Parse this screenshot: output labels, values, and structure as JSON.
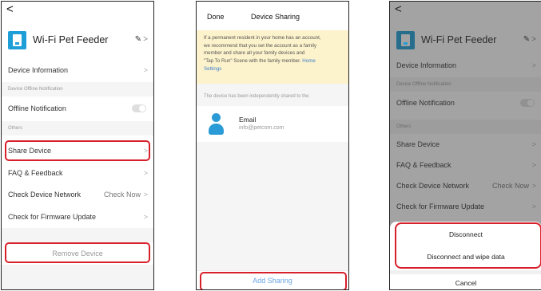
{
  "screen1": {
    "back": "<",
    "device_name": "Wi-Fi Pet Feeder",
    "edit_glyph": "✎",
    "chevron": ">",
    "items": {
      "device_information": "Device Information",
      "offline_section": "Device Offline Notification",
      "offline_notification": "Offline Notification",
      "others_section": "Others",
      "share_device": "Share Device",
      "faq": "FAQ & Feedback",
      "check_network": "Check Device Network",
      "check_now": "Check Now",
      "firmware": "Check for Firmware Update",
      "remove": "Remove Device"
    },
    "offline_toggle_on": false
  },
  "screen2": {
    "done": "Done",
    "title": "Device Sharing",
    "notice_line1": "If a permanent resident in your home has an account,",
    "notice_line2": "we recommend that you set the account as a family",
    "notice_line3": "member and share all your family devices and",
    "notice_line4": "\"Tap To Run\" Scene with the family member.",
    "notice_link_1": "Home",
    "notice_link_2": "Settings",
    "shared_hint": "The device has been independently shared to the",
    "share_label": "Email",
    "share_value": "info@petcom.com",
    "add_button": "Add Sharing"
  },
  "screen3": {
    "back": "<",
    "device_name": "Wi-Fi Pet Feeder",
    "edit_glyph": "✎",
    "chevron": ">",
    "items": {
      "device_information": "Device Information",
      "offline_section": "Device Offline Notification",
      "offline_notification": "Offline Notification",
      "others_section": "Others",
      "share_device": "Share Device",
      "faq": "FAQ & Feedback",
      "check_network": "Check Device Network",
      "check_now": "Check Now",
      "firmware": "Check for Firmware Update"
    },
    "sheet": {
      "disconnect": "Disconnect",
      "disconnect_wipe": "Disconnect and wipe data",
      "cancel": "Cancel"
    }
  },
  "colors": {
    "highlight": "#d8202a",
    "device_icon": "#1e9fd8",
    "link": "#3d7fd0",
    "notice_bg": "#fcf2cb",
    "add_sharing_text": "#6aa5e6"
  }
}
